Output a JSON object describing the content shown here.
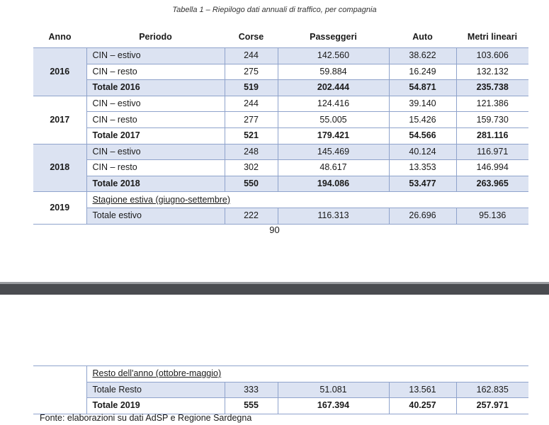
{
  "caption": "Tabella 1 – Riepilogo dati annuali di traffico, per compagnia",
  "headers": [
    "Anno",
    "Periodo",
    "Corse",
    "Passeggeri",
    "Auto",
    "Metri lineari"
  ],
  "rows": [
    {
      "anno": "2016",
      "periodo": "CIN – estivo",
      "corse": "244",
      "passeggeri": "142.560",
      "auto": "38.622",
      "metri": "103.606"
    },
    {
      "anno": "",
      "periodo": "CIN – resto",
      "corse": "275",
      "passeggeri": "59.884",
      "auto": "16.249",
      "metri": "132.132"
    },
    {
      "anno": "",
      "periodo": "Totale 2016",
      "corse": "519",
      "passeggeri": "202.444",
      "auto": "54.871",
      "metri": "235.738"
    },
    {
      "anno": "2017",
      "periodo": "CIN – estivo",
      "corse": "244",
      "passeggeri": "124.416",
      "auto": "39.140",
      "metri": "121.386"
    },
    {
      "anno": "",
      "periodo": "CIN – resto",
      "corse": "277",
      "passeggeri": "55.005",
      "auto": "15.426",
      "metri": "159.730"
    },
    {
      "anno": "",
      "periodo": "Totale 2017",
      "corse": "521",
      "passeggeri": "179.421",
      "auto": "54.566",
      "metri": "281.116"
    },
    {
      "anno": "2018",
      "periodo": "CIN – estivo",
      "corse": "248",
      "passeggeri": "145.469",
      "auto": "40.124",
      "metri": "116.971"
    },
    {
      "anno": "",
      "periodo": "CIN – resto",
      "corse": "302",
      "passeggeri": "48.617",
      "auto": "13.353",
      "metri": "146.994"
    },
    {
      "anno": "",
      "periodo": "Totale 2018",
      "corse": "550",
      "passeggeri": "194.086",
      "auto": "53.477",
      "metri": "263.965"
    },
    {
      "anno": "2019",
      "periodo": "Stagione estiva (giugno-settembre)",
      "corse": "",
      "passeggeri": "",
      "auto": "",
      "metri": ""
    },
    {
      "anno": "",
      "periodo": "Totale estivo",
      "corse": "222",
      "passeggeri": "116.313",
      "auto": "26.696",
      "metri": "95.136"
    }
  ],
  "page_number": "90",
  "continued_rows": [
    {
      "periodo": "Resto dell'anno (ottobre-maggio)",
      "corse": "",
      "passeggeri": "",
      "auto": "",
      "metri": ""
    },
    {
      "periodo": "Totale Resto",
      "corse": "333",
      "passeggeri": "51.081",
      "auto": "13.561",
      "metri": "162.835"
    },
    {
      "periodo": "Totale 2019",
      "corse": "555",
      "passeggeri": "167.394",
      "auto": "40.257",
      "metri": "257.971"
    }
  ],
  "source": "Fonte: elaborazioni su dati AdSP e Regione Sardegna"
}
